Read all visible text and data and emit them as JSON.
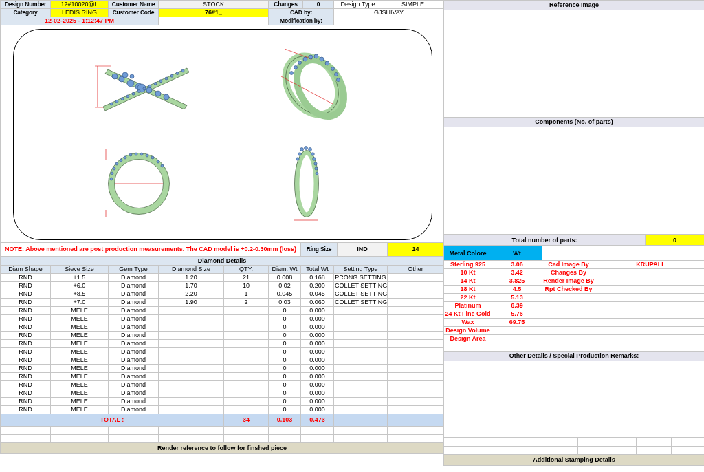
{
  "header": {
    "design_number": {
      "label": "Design Number",
      "value": "12#10020@L"
    },
    "customer_name": {
      "label": "Customer Name",
      "value": "STOCK"
    },
    "changes": {
      "label": "Changes",
      "value": "0"
    },
    "design_type": {
      "label": "Design Type",
      "value": "SIMPLE"
    },
    "category": {
      "label": "Category",
      "value": "LEDIS RING"
    },
    "customer_code": {
      "label": "Customer Code",
      "value": "76#1_"
    },
    "cad_by": {
      "label": "CAD by:",
      "value": "GJSHIVAY"
    },
    "timestamp": "12-02-2025 - 1:12:47 PM",
    "modification_by": {
      "label": "Modification by:"
    }
  },
  "note": "NOTE: Above mentioned are post production measurements. The CAD model is +0.2-0.30mm (loss)",
  "ring_size": {
    "label": "Ring Size",
    "standard": "IND",
    "value": "14"
  },
  "diamond_details": {
    "title": "Diamond Details",
    "columns": [
      "Diam Shape",
      "Sieve Size",
      "Gem Type",
      "Diamond Size",
      "QTY.",
      "Diam. Wt",
      "Total Wt",
      "Setting Type",
      "Other"
    ],
    "rows": [
      {
        "shape": "RND",
        "sieve": "+1.5",
        "gem": "Diamond",
        "size": "1.20",
        "qty": "21",
        "diam_wt": "0.008",
        "total_wt": "0.168",
        "setting": "PRONG SETTING"
      },
      {
        "shape": "RND",
        "sieve": "+6.0",
        "gem": "Diamond",
        "size": "1.70",
        "qty": "10",
        "diam_wt": "0.02",
        "total_wt": "0.200",
        "setting": "COLLET SETTING"
      },
      {
        "shape": "RND",
        "sieve": "+8.5",
        "gem": "Diamond",
        "size": "2.20",
        "qty": "1",
        "diam_wt": "0.045",
        "total_wt": "0.045",
        "setting": "COLLET SETTING"
      },
      {
        "shape": "RND",
        "sieve": "+7.0",
        "gem": "Diamond",
        "size": "1.90",
        "qty": "2",
        "diam_wt": "0.03",
        "total_wt": "0.060",
        "setting": "COLLET SETTING"
      },
      {
        "shape": "RND",
        "sieve": "MELE",
        "gem": "Diamond",
        "diam_wt": "0",
        "total_wt": "0.000"
      },
      {
        "shape": "RND",
        "sieve": "MELE",
        "gem": "Diamond",
        "diam_wt": "0",
        "total_wt": "0.000"
      },
      {
        "shape": "RND",
        "sieve": "MELE",
        "gem": "Diamond",
        "diam_wt": "0",
        "total_wt": "0.000"
      },
      {
        "shape": "RND",
        "sieve": "MELE",
        "gem": "Diamond",
        "diam_wt": "0",
        "total_wt": "0.000"
      },
      {
        "shape": "RND",
        "sieve": "MELE",
        "gem": "Diamond",
        "diam_wt": "0",
        "total_wt": "0.000"
      },
      {
        "shape": "RND",
        "sieve": "MELE",
        "gem": "Diamond",
        "diam_wt": "0",
        "total_wt": "0.000"
      },
      {
        "shape": "RND",
        "sieve": "MELE",
        "gem": "Diamond",
        "diam_wt": "0",
        "total_wt": "0.000"
      },
      {
        "shape": "RND",
        "sieve": "MELE",
        "gem": "Diamond",
        "diam_wt": "0",
        "total_wt": "0.000"
      },
      {
        "shape": "RND",
        "sieve": "MELE",
        "gem": "Diamond",
        "diam_wt": "0",
        "total_wt": "0.000"
      },
      {
        "shape": "RND",
        "sieve": "MELE",
        "gem": "Diamond",
        "diam_wt": "0",
        "total_wt": "0.000"
      },
      {
        "shape": "RND",
        "sieve": "MELE",
        "gem": "Diamond",
        "diam_wt": "0",
        "total_wt": "0.000"
      },
      {
        "shape": "RND",
        "sieve": "MELE",
        "gem": "Diamond",
        "diam_wt": "0",
        "total_wt": "0.000"
      },
      {
        "shape": "RND",
        "sieve": "MELE",
        "gem": "Diamond",
        "diam_wt": "0",
        "total_wt": "0.000"
      }
    ],
    "total": {
      "label": "TOTAL :",
      "qty": "34",
      "diam_wt": "0.103",
      "total_wt": "0.473"
    }
  },
  "reference_image": {
    "title": "Reference Image"
  },
  "components": {
    "title": "Components (No. of parts)",
    "total_label": "Total number of parts:",
    "total": "0"
  },
  "metal": {
    "columns": [
      "Metal Colore",
      "Wt"
    ],
    "rows": [
      {
        "name": "Sterling 925",
        "wt": "3.06"
      },
      {
        "name": "10 Kt",
        "wt": "3.42"
      },
      {
        "name": "14 Kt",
        "wt": "3.825"
      },
      {
        "name": "18 Kt",
        "wt": "4.5"
      },
      {
        "name": "22 Kt",
        "wt": "5.13"
      },
      {
        "name": "Platinum",
        "wt": "6.39"
      },
      {
        "name": "24 Kt Fine Gold",
        "wt": "5.76"
      },
      {
        "name": "Wax",
        "wt": "69.75"
      },
      {
        "name": "Design Volume"
      },
      {
        "name": "Design Area"
      }
    ]
  },
  "credits": [
    {
      "label": "Cad Image By",
      "value": "KRUPALI"
    },
    {
      "label": "Changes By"
    },
    {
      "label": "Render Image By"
    },
    {
      "label": "Rpt Checked By"
    }
  ],
  "other_details": {
    "title": "Other Details / Special Production Remarks:"
  },
  "footer": {
    "render_reference": "Render reference to follow for finshed piece",
    "stamping": "Additional Stamping Details"
  }
}
